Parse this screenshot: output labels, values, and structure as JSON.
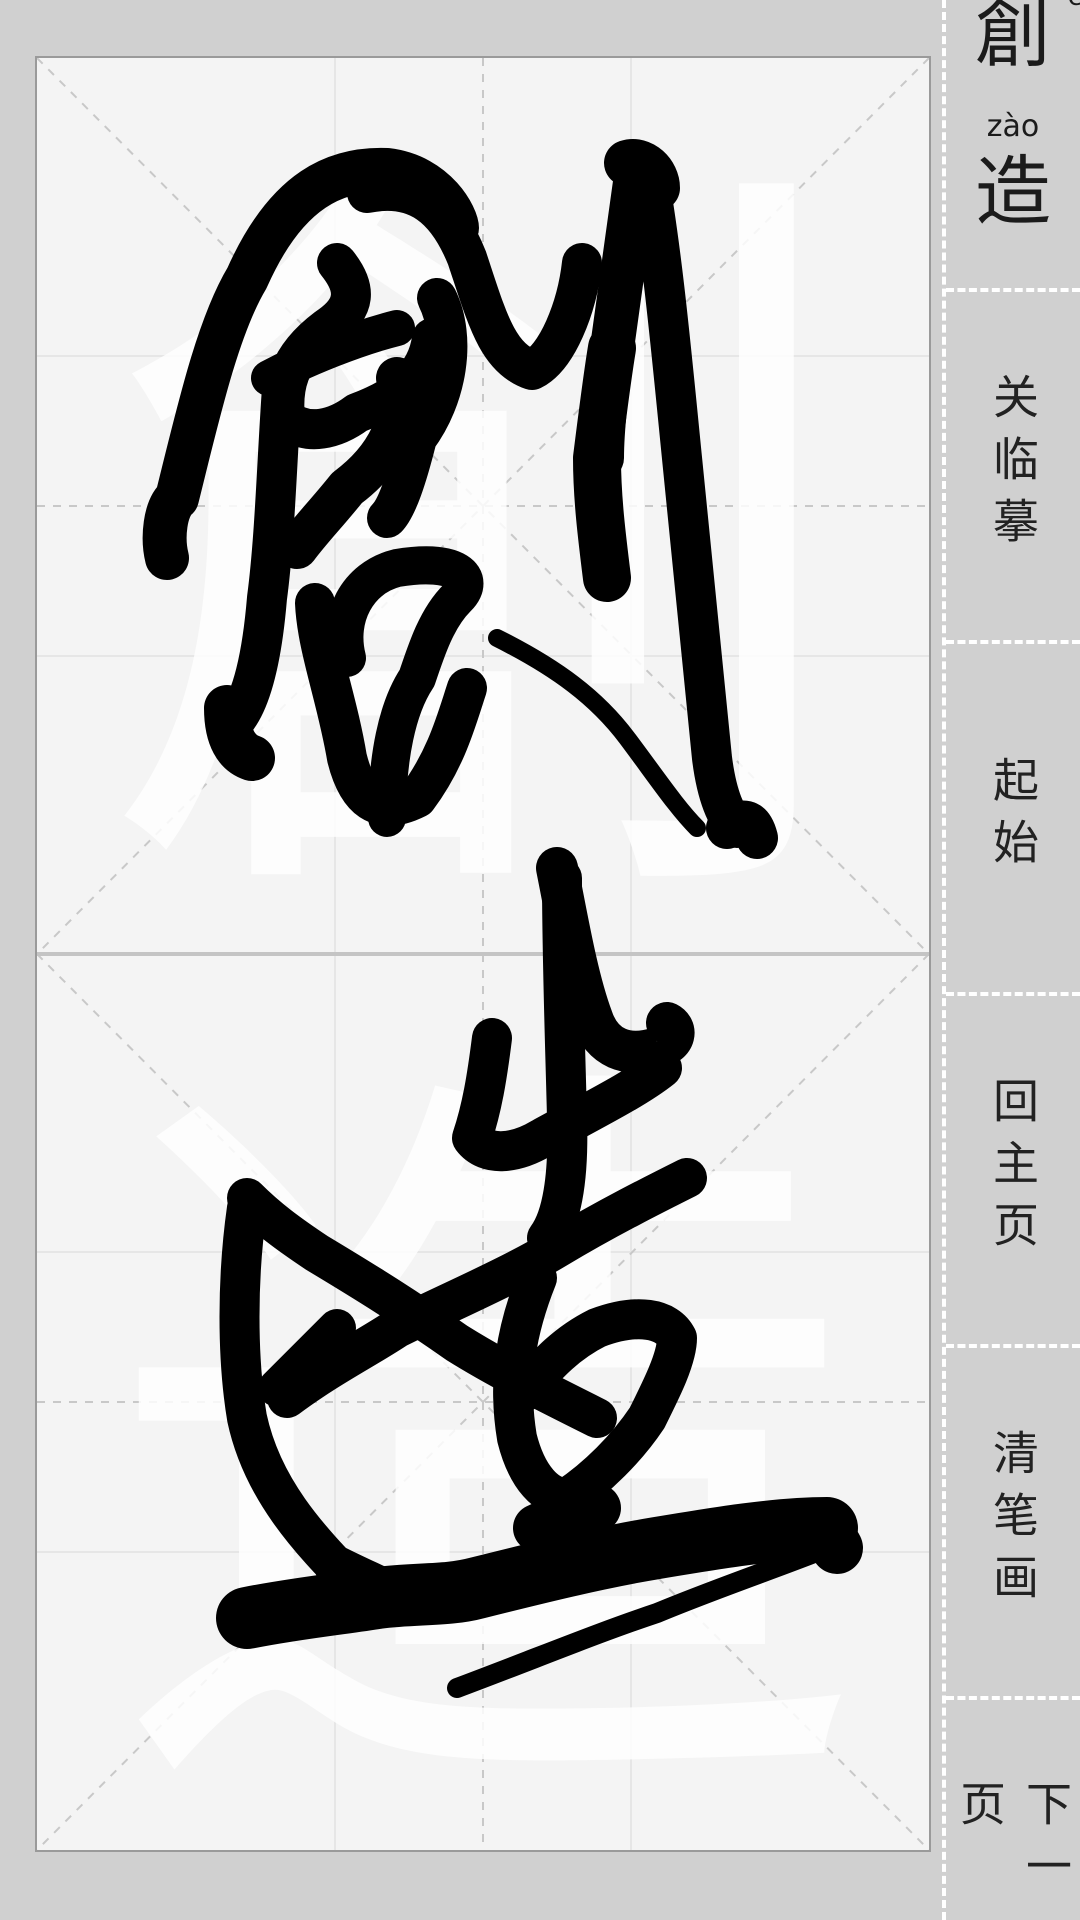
{
  "sidebar": {
    "characters": [
      {
        "char": "創",
        "pinyin": "c"
      },
      {
        "char": "造",
        "pinyin": "zào"
      }
    ],
    "buttons": [
      {
        "label": "关临摹",
        "icon": "none"
      },
      {
        "label": "起始",
        "icon": "none"
      },
      {
        "label": "回主页",
        "icon": "none"
      },
      {
        "label": "清笔画",
        "icon": "none"
      },
      {
        "label": "下一页",
        "icon": "none"
      }
    ]
  },
  "canvas": {
    "guide_characters": [
      "創",
      "造"
    ],
    "colors": {
      "ink": "#000000",
      "guide_text": "#ffffff",
      "grid_line": "#c8c8c8",
      "background": "#f4f4f4"
    }
  }
}
